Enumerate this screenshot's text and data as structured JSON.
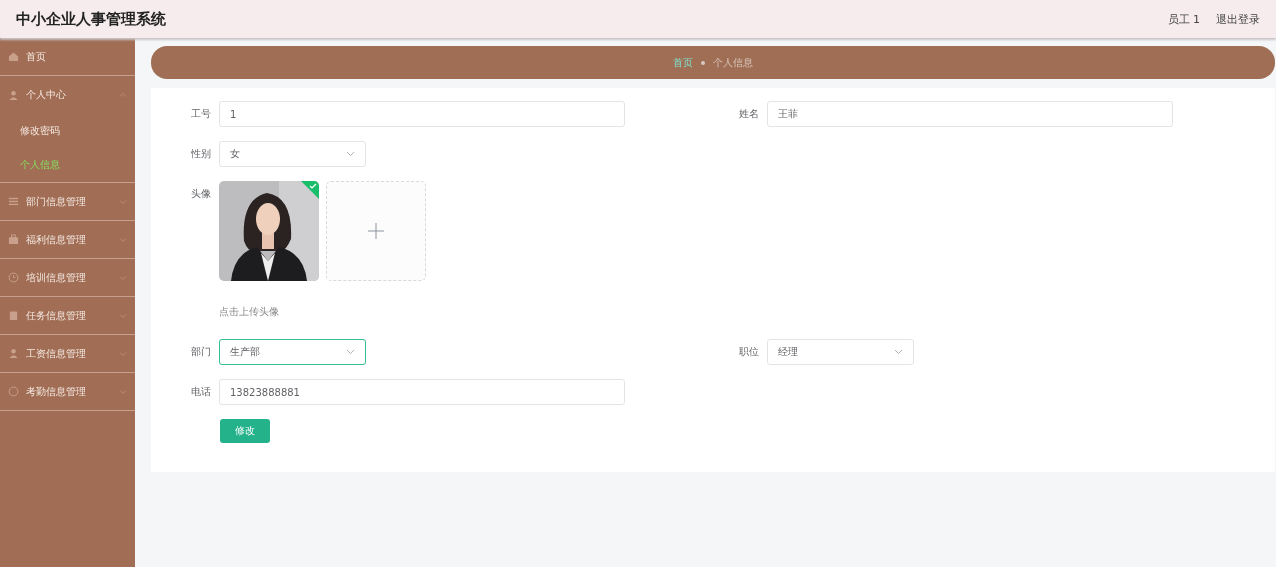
{
  "header": {
    "title": "中小企业人事管理系统",
    "user": "员工 1",
    "logout": "退出登录"
  },
  "sidebar": {
    "items": [
      {
        "label": "首页"
      },
      {
        "label": "个人中心",
        "expanded": true,
        "children": [
          {
            "label": "修改密码",
            "selected": false
          },
          {
            "label": "个人信息",
            "selected": true
          }
        ]
      },
      {
        "label": "部门信息管理",
        "expanded": false
      },
      {
        "label": "福利信息管理",
        "expanded": false
      },
      {
        "label": "培训信息管理",
        "expanded": false
      },
      {
        "label": "任务信息管理",
        "expanded": false
      },
      {
        "label": "工资信息管理",
        "expanded": false
      },
      {
        "label": "考勤信息管理",
        "expanded": false
      }
    ]
  },
  "breadcrumb": [
    {
      "label": "首页",
      "selected": false
    },
    {
      "label": "个人信息",
      "selected": true
    }
  ],
  "form": {
    "rows": [
      [
        {
          "label": "工号",
          "kind": "input",
          "value": "1"
        },
        {
          "label": "姓名",
          "kind": "input",
          "value": "王菲"
        }
      ],
      [
        {
          "label": "性别",
          "kind": "select",
          "value": "女",
          "focused": false
        }
      ],
      [
        {
          "label": "头像",
          "kind": "upload",
          "uploaded": true,
          "hint": "点击上传头像"
        }
      ],
      [
        {
          "label": "部门",
          "kind": "select",
          "value": "生产部",
          "focused": true
        },
        {
          "label": "职位",
          "kind": "select",
          "value": "经理",
          "focused": false
        }
      ],
      [
        {
          "label": "电话",
          "kind": "input",
          "value": "13823888881"
        }
      ]
    ],
    "submit": "修改"
  }
}
